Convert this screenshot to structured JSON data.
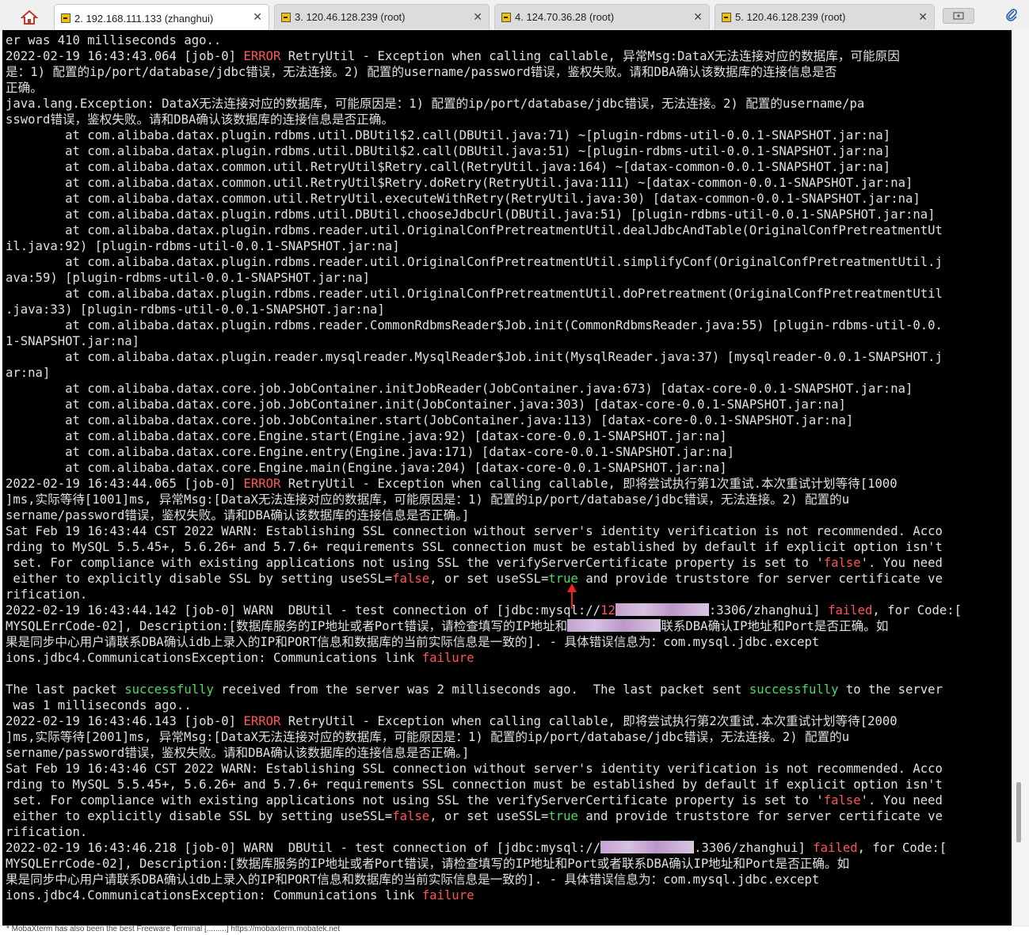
{
  "tabs": [
    {
      "label": "2. 192.168.111.133 (zhanghui)",
      "active": true
    },
    {
      "label": "3. 120.46.128.239 (root)",
      "active": false
    },
    {
      "label": "4. 124.70.36.28 (root)",
      "active": false
    },
    {
      "label": "5. 120.46.128.239 (root)",
      "active": false
    }
  ],
  "tab_close_glyph": "✕",
  "colors": {
    "terminal_bg": "#000000",
    "terminal_fg": "#e0e0e0",
    "error_red": "#ff5555",
    "success_green": "#4cd964"
  },
  "icons": {
    "home": "home-icon",
    "new_tab": "new-tab-icon",
    "attach": "paperclip-icon",
    "arrow": "red-arrow-annotation"
  },
  "terminal": {
    "lines": [
      [
        {
          "t": "er was 410 milliseconds ago.."
        }
      ],
      [
        {
          "t": "2022-02-19 16:43:43.064 [job-0] "
        },
        {
          "t": "ERROR",
          "c": "red"
        },
        {
          "t": " RetryUtil - Exception when calling callable, 异常Msg:DataX无法连接对应的数据库，可能原因"
        }
      ],
      [
        {
          "t": "是：1) 配置的ip/port/database/jdbc错误，无法连接。2) 配置的username/password错误，鉴权失败。请和DBA确认该数据库的连接信息是否"
        }
      ],
      [
        {
          "t": "正确。"
        }
      ],
      [
        {
          "t": "java.lang.Exception: DataX无法连接对应的数据库，可能原因是：1) 配置的ip/port/database/jdbc错误，无法连接。2) 配置的username/pa"
        }
      ],
      [
        {
          "t": "ssword错误，鉴权失败。请和DBA确认该数据库的连接信息是否正确。"
        }
      ],
      [
        {
          "t": "        at com.alibaba.datax.plugin.rdbms.util.DBUtil$2.call(DBUtil.java:71) ~[plugin-rdbms-util-0.0.1-SNAPSHOT.jar:na]"
        }
      ],
      [
        {
          "t": "        at com.alibaba.datax.plugin.rdbms.util.DBUtil$2.call(DBUtil.java:51) ~[plugin-rdbms-util-0.0.1-SNAPSHOT.jar:na]"
        }
      ],
      [
        {
          "t": "        at com.alibaba.datax.common.util.RetryUtil$Retry.call(RetryUtil.java:164) ~[datax-common-0.0.1-SNAPSHOT.jar:na]"
        }
      ],
      [
        {
          "t": "        at com.alibaba.datax.common.util.RetryUtil$Retry.doRetry(RetryUtil.java:111) ~[datax-common-0.0.1-SNAPSHOT.jar:na]"
        }
      ],
      [
        {
          "t": "        at com.alibaba.datax.common.util.RetryUtil.executeWithRetry(RetryUtil.java:30) [datax-common-0.0.1-SNAPSHOT.jar:na]"
        }
      ],
      [
        {
          "t": "        at com.alibaba.datax.plugin.rdbms.util.DBUtil.chooseJdbcUrl(DBUtil.java:51) [plugin-rdbms-util-0.0.1-SNAPSHOT.jar:na]"
        }
      ],
      [
        {
          "t": "        at com.alibaba.datax.plugin.rdbms.reader.util.OriginalConfPretreatmentUtil.dealJdbcAndTable(OriginalConfPretreatmentUt"
        }
      ],
      [
        {
          "t": "il.java:92) [plugin-rdbms-util-0.0.1-SNAPSHOT.jar:na]"
        }
      ],
      [
        {
          "t": "        at com.alibaba.datax.plugin.rdbms.reader.util.OriginalConfPretreatmentUtil.simplifyConf(OriginalConfPretreatmentUtil.j"
        }
      ],
      [
        {
          "t": "ava:59) [plugin-rdbms-util-0.0.1-SNAPSHOT.jar:na]"
        }
      ],
      [
        {
          "t": "        at com.alibaba.datax.plugin.rdbms.reader.util.OriginalConfPretreatmentUtil.doPretreatment(OriginalConfPretreatmentUtil"
        }
      ],
      [
        {
          "t": ".java:33) [plugin-rdbms-util-0.0.1-SNAPSHOT.jar:na]"
        }
      ],
      [
        {
          "t": "        at com.alibaba.datax.plugin.rdbms.reader.CommonRdbmsReader$Job.init(CommonRdbmsReader.java:55) [plugin-rdbms-util-0.0."
        }
      ],
      [
        {
          "t": "1-SNAPSHOT.jar:na]"
        }
      ],
      [
        {
          "t": "        at com.alibaba.datax.plugin.reader.mysqlreader.MysqlReader$Job.init(MysqlReader.java:37) [mysqlreader-0.0.1-SNAPSHOT.j"
        }
      ],
      [
        {
          "t": "ar:na]"
        }
      ],
      [
        {
          "t": "        at com.alibaba.datax.core.job.JobContainer.initJobReader(JobContainer.java:673) [datax-core-0.0.1-SNAPSHOT.jar:na]"
        }
      ],
      [
        {
          "t": "        at com.alibaba.datax.core.job.JobContainer.init(JobContainer.java:303) [datax-core-0.0.1-SNAPSHOT.jar:na]"
        }
      ],
      [
        {
          "t": "        at com.alibaba.datax.core.job.JobContainer.start(JobContainer.java:113) [datax-core-0.0.1-SNAPSHOT.jar:na]"
        }
      ],
      [
        {
          "t": "        at com.alibaba.datax.core.Engine.start(Engine.java:92) [datax-core-0.0.1-SNAPSHOT.jar:na]"
        }
      ],
      [
        {
          "t": "        at com.alibaba.datax.core.Engine.entry(Engine.java:171) [datax-core-0.0.1-SNAPSHOT.jar:na]"
        }
      ],
      [
        {
          "t": "        at com.alibaba.datax.core.Engine.main(Engine.java:204) [datax-core-0.0.1-SNAPSHOT.jar:na]"
        }
      ],
      [
        {
          "t": "2022-02-19 16:43:44.065 [job-0] "
        },
        {
          "t": "ERROR",
          "c": "red"
        },
        {
          "t": " RetryUtil - Exception when calling callable, 即将尝试执行第1次重试.本次重试计划等待[1000"
        }
      ],
      [
        {
          "t": "]ms,实际等待[1001]ms, 异常Msg:[DataX无法连接对应的数据库，可能原因是：1) 配置的ip/port/database/jdbc错误，无法连接。2) 配置的u"
        }
      ],
      [
        {
          "t": "sername/password错误，鉴权失败。请和DBA确认该数据库的连接信息是否正确。]"
        }
      ],
      [
        {
          "t": "Sat Feb 19 16:43:44 CST 2022 WARN: Establishing SSL connection without server's identity verification is not recommended. Acco"
        }
      ],
      [
        {
          "t": "rding to MySQL 5.5.45+, 5.6.26+ and 5.7.6+ requirements SSL connection must be established by default if explicit option isn't"
        }
      ],
      [
        {
          "t": " set. For compliance with existing applications not using SSL the verifyServerCertificate property is set to '"
        },
        {
          "t": "false",
          "c": "red"
        },
        {
          "t": "'. You need"
        }
      ],
      [
        {
          "t": " either to explicitly disable SSL by setting useSSL="
        },
        {
          "t": "false",
          "c": "red"
        },
        {
          "t": ", or set useSSL="
        },
        {
          "t": "true",
          "c": "green"
        },
        {
          "t": " and provide truststore for server certificate ve"
        }
      ],
      [
        {
          "t": "rification."
        }
      ],
      [
        {
          "t": "2022-02-19 16:43:44.142 [job-0] WARN  DBUtil - test connection of [jdbc:mysql://"
        },
        {
          "t": "12",
          "c": "red"
        },
        {
          "redact": true
        },
        {
          "t": ":3306/zhanghui] "
        },
        {
          "t": "failed",
          "c": "red"
        },
        {
          "t": ", for Code:["
        }
      ],
      [
        {
          "t": "MYSQLErrCode-02], Description:[数据库服务的IP地址或者Port错误，请检查填写的IP地址和"
        },
        {
          "redact": true
        },
        {
          "t": "联系DBA确认IP地址和Port是否正确。如"
        }
      ],
      [
        {
          "t": "果是同步中心用户请联系DBA确认idb上录入的IP和PORT信息和数据库的当前实际信息是一致的]. - 具体错误信息为：com.mysql.jdbc.except"
        }
      ],
      [
        {
          "t": "ions.jdbc4.CommunicationsException: Communications link "
        },
        {
          "t": "failure",
          "c": "red"
        }
      ],
      [
        {
          "t": ""
        }
      ],
      [
        {
          "t": "The last packet "
        },
        {
          "t": "successfully",
          "c": "green"
        },
        {
          "t": " received from the server was 2 milliseconds ago.  The last packet sent "
        },
        {
          "t": "successfully",
          "c": "green"
        },
        {
          "t": " to the server"
        }
      ],
      [
        {
          "t": " was 1 milliseconds ago.."
        }
      ],
      [
        {
          "t": "2022-02-19 16:43:46.143 [job-0] "
        },
        {
          "t": "ERROR",
          "c": "red"
        },
        {
          "t": " RetryUtil - Exception when calling callable, 即将尝试执行第2次重试.本次重试计划等待[2000"
        }
      ],
      [
        {
          "t": "]ms,实际等待[2001]ms, 异常Msg:[DataX无法连接对应的数据库，可能原因是：1) 配置的ip/port/database/jdbc错误，无法连接。2) 配置的u"
        }
      ],
      [
        {
          "t": "sername/password错误，鉴权失败。请和DBA确认该数据库的连接信息是否正确。]"
        }
      ],
      [
        {
          "t": "Sat Feb 19 16:43:46 CST 2022 WARN: Establishing SSL connection without server's identity verification is not recommended. Acco"
        }
      ],
      [
        {
          "t": "rding to MySQL 5.5.45+, 5.6.26+ and 5.7.6+ requirements SSL connection must be established by default if explicit option isn't"
        }
      ],
      [
        {
          "t": " set. For compliance with existing applications not using SSL the verifyServerCertificate property is set to '"
        },
        {
          "t": "false",
          "c": "red"
        },
        {
          "t": "'. You need"
        }
      ],
      [
        {
          "t": " either to explicitly disable SSL by setting useSSL="
        },
        {
          "t": "false",
          "c": "red"
        },
        {
          "t": ", or set useSSL="
        },
        {
          "t": "true",
          "c": "green"
        },
        {
          "t": " and provide truststore for server certificate ve"
        }
      ],
      [
        {
          "t": "rification."
        }
      ],
      [
        {
          "t": "2022-02-19 16:43:46.218 [job-0] WARN  DBUtil - test connection of [jdbc:mysql://"
        },
        {
          "redact": true
        },
        {
          "t": ".3306/zhanghui] "
        },
        {
          "t": "failed",
          "c": "red"
        },
        {
          "t": ", for Code:["
        }
      ],
      [
        {
          "t": "MYSQLErrCode-02], Description:[数据库服务的IP地址或者Port错误，请检查填写的IP地址和Port或者联系DBA确认IP地址和Port是否正确。如"
        }
      ],
      [
        {
          "t": "果是同步中心用户请联系DBA确认idb上录入的IP和PORT信息和数据库的当前实际信息是一致的]. - 具体错误信息为：com.mysql.jdbc.except"
        }
      ],
      [
        {
          "t": "ions.jdbc4.CommunicationsException: Communications link "
        },
        {
          "t": "failure",
          "c": "red"
        }
      ]
    ]
  },
  "status_bar_text": "* MobaXterm has also been the best Freeware Terminal [.........] https://mobaxterm.mobatek.net"
}
